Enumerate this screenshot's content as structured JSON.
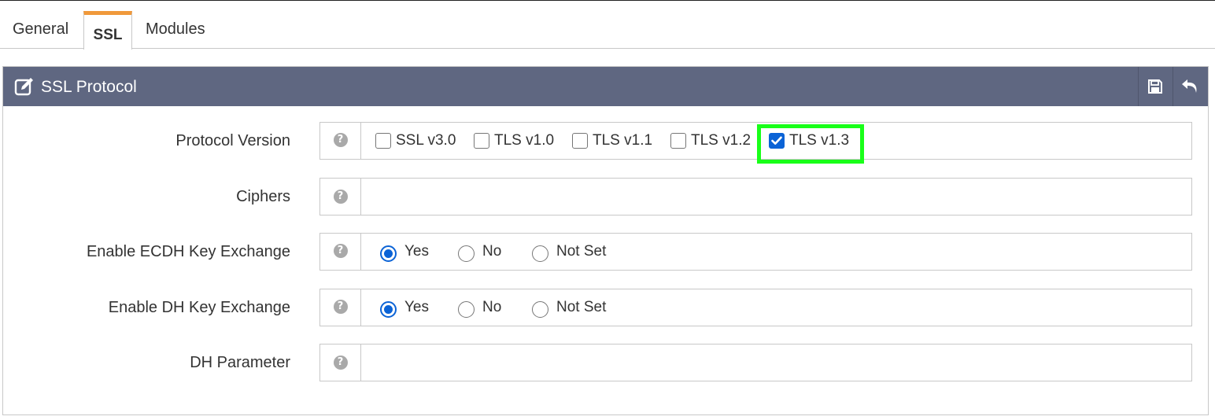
{
  "tabs": [
    {
      "label": "General"
    },
    {
      "label": "SSL"
    },
    {
      "label": "Modules"
    }
  ],
  "panel": {
    "title": "SSL Protocol",
    "header_icon": "edit-icon",
    "actions": [
      "save-icon",
      "undo-icon"
    ]
  },
  "rows": {
    "protocol": {
      "label": "Protocol Version",
      "help": "?",
      "options": [
        {
          "label": "SSL v3.0",
          "checked": false
        },
        {
          "label": "TLS v1.0",
          "checked": false
        },
        {
          "label": "TLS v1.1",
          "checked": false
        },
        {
          "label": "TLS v1.2",
          "checked": false
        },
        {
          "label": "TLS v1.3",
          "checked": true
        }
      ]
    },
    "ciphers": {
      "label": "Ciphers",
      "help": "?",
      "value": ""
    },
    "ecdh": {
      "label": "Enable ECDH Key Exchange",
      "help": "?",
      "options": [
        {
          "label": "Yes",
          "selected": true
        },
        {
          "label": "No",
          "selected": false
        },
        {
          "label": "Not Set",
          "selected": false
        }
      ]
    },
    "dh": {
      "label": "Enable DH Key Exchange",
      "help": "?",
      "options": [
        {
          "label": "Yes",
          "selected": true
        },
        {
          "label": "No",
          "selected": false
        },
        {
          "label": "Not Set",
          "selected": false
        }
      ]
    },
    "dhparam": {
      "label": "DH Parameter",
      "help": "?",
      "value": ""
    }
  },
  "colors": {
    "header_bg": "#5f6781",
    "active_tab_accent": "#f0993b",
    "control_blue": "#0b63d6",
    "highlight": "#19ff19"
  }
}
